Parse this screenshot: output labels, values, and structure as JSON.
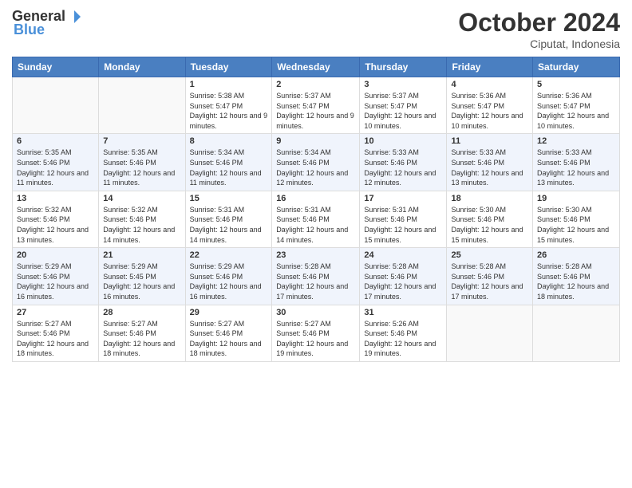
{
  "header": {
    "logo_general": "General",
    "logo_blue": "Blue",
    "month_title": "October 2024",
    "location": "Ciputat, Indonesia"
  },
  "days_of_week": [
    "Sunday",
    "Monday",
    "Tuesday",
    "Wednesday",
    "Thursday",
    "Friday",
    "Saturday"
  ],
  "weeks": [
    [
      {
        "day": "",
        "info": ""
      },
      {
        "day": "",
        "info": ""
      },
      {
        "day": "1",
        "sunrise": "Sunrise: 5:38 AM",
        "sunset": "Sunset: 5:47 PM",
        "daylight": "Daylight: 12 hours and 9 minutes."
      },
      {
        "day": "2",
        "sunrise": "Sunrise: 5:37 AM",
        "sunset": "Sunset: 5:47 PM",
        "daylight": "Daylight: 12 hours and 9 minutes."
      },
      {
        "day": "3",
        "sunrise": "Sunrise: 5:37 AM",
        "sunset": "Sunset: 5:47 PM",
        "daylight": "Daylight: 12 hours and 10 minutes."
      },
      {
        "day": "4",
        "sunrise": "Sunrise: 5:36 AM",
        "sunset": "Sunset: 5:47 PM",
        "daylight": "Daylight: 12 hours and 10 minutes."
      },
      {
        "day": "5",
        "sunrise": "Sunrise: 5:36 AM",
        "sunset": "Sunset: 5:47 PM",
        "daylight": "Daylight: 12 hours and 10 minutes."
      }
    ],
    [
      {
        "day": "6",
        "sunrise": "Sunrise: 5:35 AM",
        "sunset": "Sunset: 5:46 PM",
        "daylight": "Daylight: 12 hours and 11 minutes."
      },
      {
        "day": "7",
        "sunrise": "Sunrise: 5:35 AM",
        "sunset": "Sunset: 5:46 PM",
        "daylight": "Daylight: 12 hours and 11 minutes."
      },
      {
        "day": "8",
        "sunrise": "Sunrise: 5:34 AM",
        "sunset": "Sunset: 5:46 PM",
        "daylight": "Daylight: 12 hours and 11 minutes."
      },
      {
        "day": "9",
        "sunrise": "Sunrise: 5:34 AM",
        "sunset": "Sunset: 5:46 PM",
        "daylight": "Daylight: 12 hours and 12 minutes."
      },
      {
        "day": "10",
        "sunrise": "Sunrise: 5:33 AM",
        "sunset": "Sunset: 5:46 PM",
        "daylight": "Daylight: 12 hours and 12 minutes."
      },
      {
        "day": "11",
        "sunrise": "Sunrise: 5:33 AM",
        "sunset": "Sunset: 5:46 PM",
        "daylight": "Daylight: 12 hours and 13 minutes."
      },
      {
        "day": "12",
        "sunrise": "Sunrise: 5:33 AM",
        "sunset": "Sunset: 5:46 PM",
        "daylight": "Daylight: 12 hours and 13 minutes."
      }
    ],
    [
      {
        "day": "13",
        "sunrise": "Sunrise: 5:32 AM",
        "sunset": "Sunset: 5:46 PM",
        "daylight": "Daylight: 12 hours and 13 minutes."
      },
      {
        "day": "14",
        "sunrise": "Sunrise: 5:32 AM",
        "sunset": "Sunset: 5:46 PM",
        "daylight": "Daylight: 12 hours and 14 minutes."
      },
      {
        "day": "15",
        "sunrise": "Sunrise: 5:31 AM",
        "sunset": "Sunset: 5:46 PM",
        "daylight": "Daylight: 12 hours and 14 minutes."
      },
      {
        "day": "16",
        "sunrise": "Sunrise: 5:31 AM",
        "sunset": "Sunset: 5:46 PM",
        "daylight": "Daylight: 12 hours and 14 minutes."
      },
      {
        "day": "17",
        "sunrise": "Sunrise: 5:31 AM",
        "sunset": "Sunset: 5:46 PM",
        "daylight": "Daylight: 12 hours and 15 minutes."
      },
      {
        "day": "18",
        "sunrise": "Sunrise: 5:30 AM",
        "sunset": "Sunset: 5:46 PM",
        "daylight": "Daylight: 12 hours and 15 minutes."
      },
      {
        "day": "19",
        "sunrise": "Sunrise: 5:30 AM",
        "sunset": "Sunset: 5:46 PM",
        "daylight": "Daylight: 12 hours and 15 minutes."
      }
    ],
    [
      {
        "day": "20",
        "sunrise": "Sunrise: 5:29 AM",
        "sunset": "Sunset: 5:46 PM",
        "daylight": "Daylight: 12 hours and 16 minutes."
      },
      {
        "day": "21",
        "sunrise": "Sunrise: 5:29 AM",
        "sunset": "Sunset: 5:45 PM",
        "daylight": "Daylight: 12 hours and 16 minutes."
      },
      {
        "day": "22",
        "sunrise": "Sunrise: 5:29 AM",
        "sunset": "Sunset: 5:46 PM",
        "daylight": "Daylight: 12 hours and 16 minutes."
      },
      {
        "day": "23",
        "sunrise": "Sunrise: 5:28 AM",
        "sunset": "Sunset: 5:46 PM",
        "daylight": "Daylight: 12 hours and 17 minutes."
      },
      {
        "day": "24",
        "sunrise": "Sunrise: 5:28 AM",
        "sunset": "Sunset: 5:46 PM",
        "daylight": "Daylight: 12 hours and 17 minutes."
      },
      {
        "day": "25",
        "sunrise": "Sunrise: 5:28 AM",
        "sunset": "Sunset: 5:46 PM",
        "daylight": "Daylight: 12 hours and 17 minutes."
      },
      {
        "day": "26",
        "sunrise": "Sunrise: 5:28 AM",
        "sunset": "Sunset: 5:46 PM",
        "daylight": "Daylight: 12 hours and 18 minutes."
      }
    ],
    [
      {
        "day": "27",
        "sunrise": "Sunrise: 5:27 AM",
        "sunset": "Sunset: 5:46 PM",
        "daylight": "Daylight: 12 hours and 18 minutes."
      },
      {
        "day": "28",
        "sunrise": "Sunrise: 5:27 AM",
        "sunset": "Sunset: 5:46 PM",
        "daylight": "Daylight: 12 hours and 18 minutes."
      },
      {
        "day": "29",
        "sunrise": "Sunrise: 5:27 AM",
        "sunset": "Sunset: 5:46 PM",
        "daylight": "Daylight: 12 hours and 18 minutes."
      },
      {
        "day": "30",
        "sunrise": "Sunrise: 5:27 AM",
        "sunset": "Sunset: 5:46 PM",
        "daylight": "Daylight: 12 hours and 19 minutes."
      },
      {
        "day": "31",
        "sunrise": "Sunrise: 5:26 AM",
        "sunset": "Sunset: 5:46 PM",
        "daylight": "Daylight: 12 hours and 19 minutes."
      },
      {
        "day": "",
        "info": ""
      },
      {
        "day": "",
        "info": ""
      }
    ]
  ]
}
